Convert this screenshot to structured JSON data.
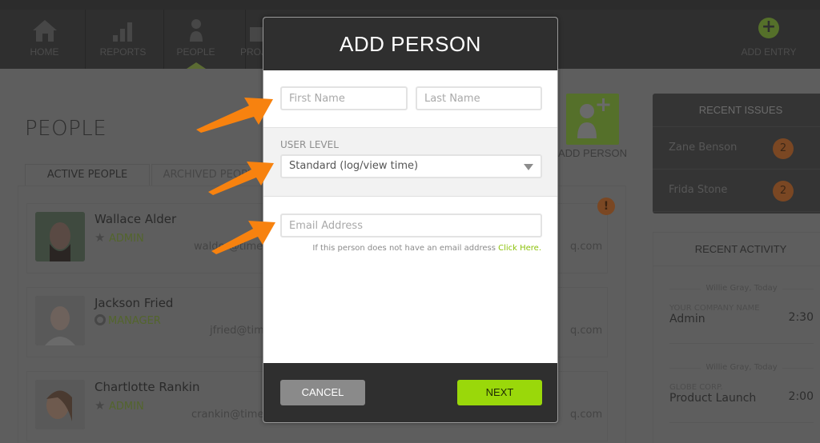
{
  "nav": {
    "items": [
      {
        "label": "HOME",
        "icon": "home-icon"
      },
      {
        "label": "REPORTS",
        "icon": "bar-chart-icon"
      },
      {
        "label": "PEOPLE",
        "icon": "person-icon",
        "active": true
      },
      {
        "label": "PROJECTS",
        "icon": "briefcase-icon"
      }
    ],
    "add_entry_label": "ADD ENTRY"
  },
  "page": {
    "title": "PEOPLE",
    "tabs": [
      {
        "label": "ACTIVE PEOPLE",
        "active": true
      },
      {
        "label": "ARCHIVED PEOPLE",
        "active": false
      }
    ],
    "add_person_label": "ADD PERSON",
    "people": [
      {
        "name": "Wallace Alder",
        "role": "ADMIN",
        "role_icon": "star-icon",
        "email": "walder@timeiq.com",
        "email_tail": "q.com"
      },
      {
        "name": "Jackson Fried",
        "role": "MANAGER",
        "role_icon": "ring-icon",
        "email": "jfried@timeiq.com",
        "email_tail": "q.com"
      },
      {
        "name": "Chartlotte Rankin",
        "role": "ADMIN",
        "role_icon": "star-icon",
        "email": "crankin@timeiq.com",
        "email_tail": "q.com"
      }
    ],
    "alert_badge": "!"
  },
  "sidebar": {
    "recent_issues": {
      "title": "RECENT ISSUES",
      "items": [
        {
          "name": "Zane Benson",
          "count": "2"
        },
        {
          "name": "Frida Stone",
          "count": "2"
        }
      ]
    },
    "recent_activity": {
      "title": "RECENT ACTIVITY",
      "items": [
        {
          "who": "Willie Gray, Today",
          "company": "YOUR COMPANY NAME",
          "task": "Admin",
          "duration": "2:30"
        },
        {
          "who": "Willie Gray, Today",
          "company": "GLOBE CORP.",
          "task": "Product Launch",
          "duration": "2:00"
        }
      ]
    }
  },
  "modal": {
    "title": "ADD PERSON",
    "first_name": {
      "placeholder": "First Name",
      "value": ""
    },
    "last_name": {
      "placeholder": "Last Name",
      "value": ""
    },
    "user_level_label": "USER LEVEL",
    "user_level_value": "Standard (log/view time)",
    "email": {
      "placeholder": "Email Address",
      "value": ""
    },
    "email_hint": "If this person does not have an email address",
    "email_hint_link": "Click Here.",
    "cancel_label": "CANCEL",
    "next_label": "NEXT"
  },
  "colors": {
    "accent_green": "#9ad80a",
    "arrow_orange": "#f7820f",
    "header_dark": "#2f2f2f"
  }
}
